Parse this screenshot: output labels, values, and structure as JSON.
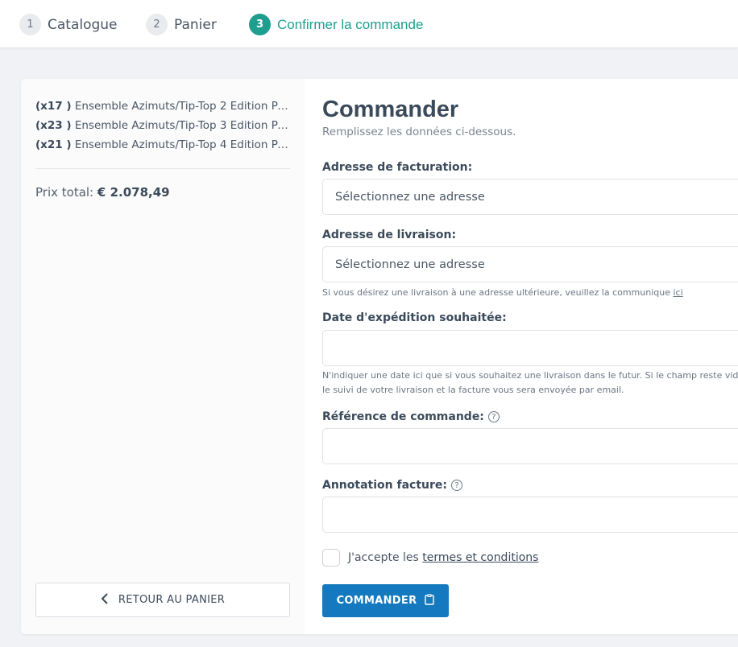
{
  "stepper": {
    "steps": [
      {
        "num": "1",
        "label": "Catalogue"
      },
      {
        "num": "2",
        "label": "Panier"
      },
      {
        "num": "3",
        "label": "Confirmer la commande"
      }
    ],
    "active_step": 3,
    "accent_color": "#1f9e8f"
  },
  "summary": {
    "items": [
      {
        "qty": "(x17 )",
        "name": "Ensemble Azimuts/Tip-Top 2 Edition Pa..."
      },
      {
        "qty": "(x23 )",
        "name": "Ensemble Azimuts/Tip-Top 3 Edition Pa..."
      },
      {
        "qty": "(x21 )",
        "name": "Ensemble Azimuts/Tip-Top 4 Edition Pa..."
      }
    ],
    "total_label": "Prix total:",
    "total_value": "€ 2.078,49",
    "back_button": "RETOUR AU PANIER"
  },
  "form": {
    "title": "Commander",
    "subtitle": "Remplissez les données ci-dessous.",
    "billing_label": "Adresse de facturation:",
    "billing_value": "Sélectionnez une adresse",
    "shipping_label": "Adresse de livraison:",
    "shipping_value": "Sélectionnez une adresse",
    "shipping_hint": "Si vous désirez une livraison à une adresse ultérieure, veuillez la communique",
    "shipping_hint_link": "ici",
    "date_label": "Date d'expédition souhaitée:",
    "date_value": "",
    "date_hint_line1": "N'indiquer une date ici que si vous souhaitez une livraison dans le futur. Si le champ reste vide",
    "date_hint_line2": "le suivi de votre livraison et la facture vous sera envoyée par email.",
    "reference_label": "Référence de commande:",
    "reference_value": "",
    "annotation_label": "Annotation facture:",
    "annotation_value": "",
    "terms_prefix": "J'accepte les",
    "terms_link": "termes et conditions",
    "terms_checked": false,
    "submit_button": "COMMANDER",
    "submit_color": "#1479be"
  }
}
